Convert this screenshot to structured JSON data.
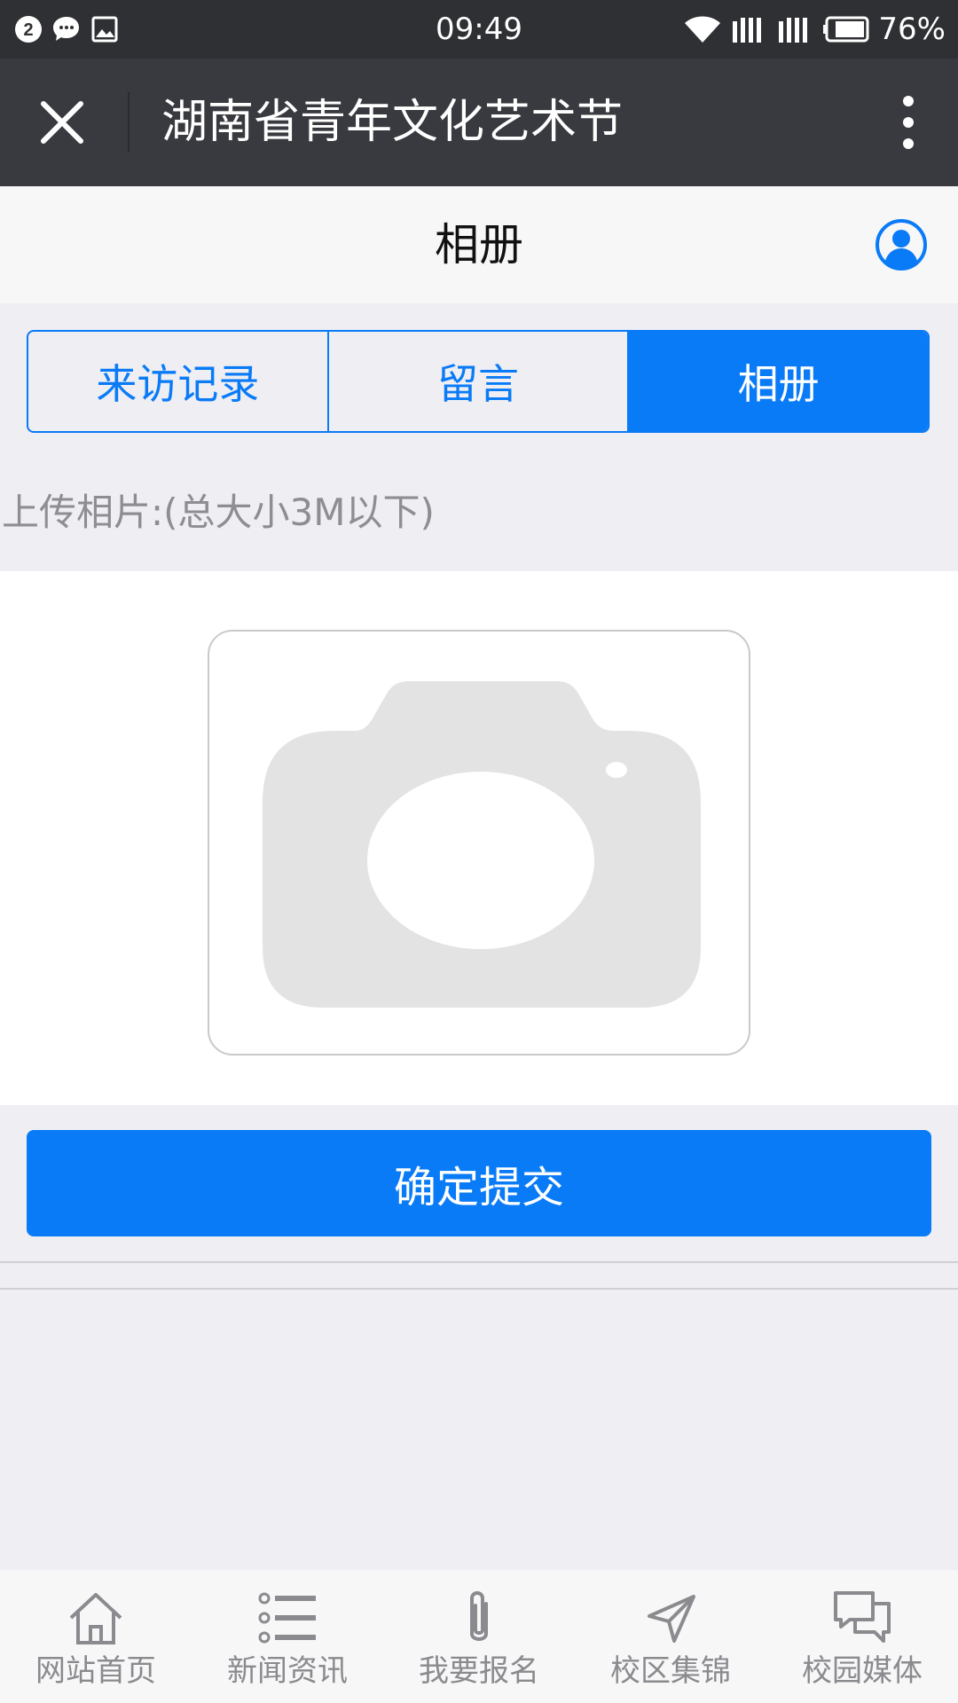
{
  "status_bar": {
    "notification_count": "2",
    "time": "09:49",
    "battery_percent": "76%"
  },
  "app_bar": {
    "title": "湖南省青年文化艺术节"
  },
  "page": {
    "title": "相册"
  },
  "tabs": [
    {
      "label": "来访记录",
      "active": false
    },
    {
      "label": "留言",
      "active": false
    },
    {
      "label": "相册",
      "active": true
    }
  ],
  "upload": {
    "label": "上传相片:(总大小3M以下)"
  },
  "submit": {
    "label": "确定提交"
  },
  "bottom_nav": [
    {
      "label": "网站首页",
      "icon": "home-icon"
    },
    {
      "label": "新闻资讯",
      "icon": "list-icon"
    },
    {
      "label": "我要报名",
      "icon": "paperclip-icon"
    },
    {
      "label": "校区集锦",
      "icon": "send-icon"
    },
    {
      "label": "校园媒体",
      "icon": "chat-icon"
    }
  ],
  "colors": {
    "accent": "#0a7bf7",
    "app_bar": "#393a3f",
    "status_bar": "#2f3033"
  }
}
